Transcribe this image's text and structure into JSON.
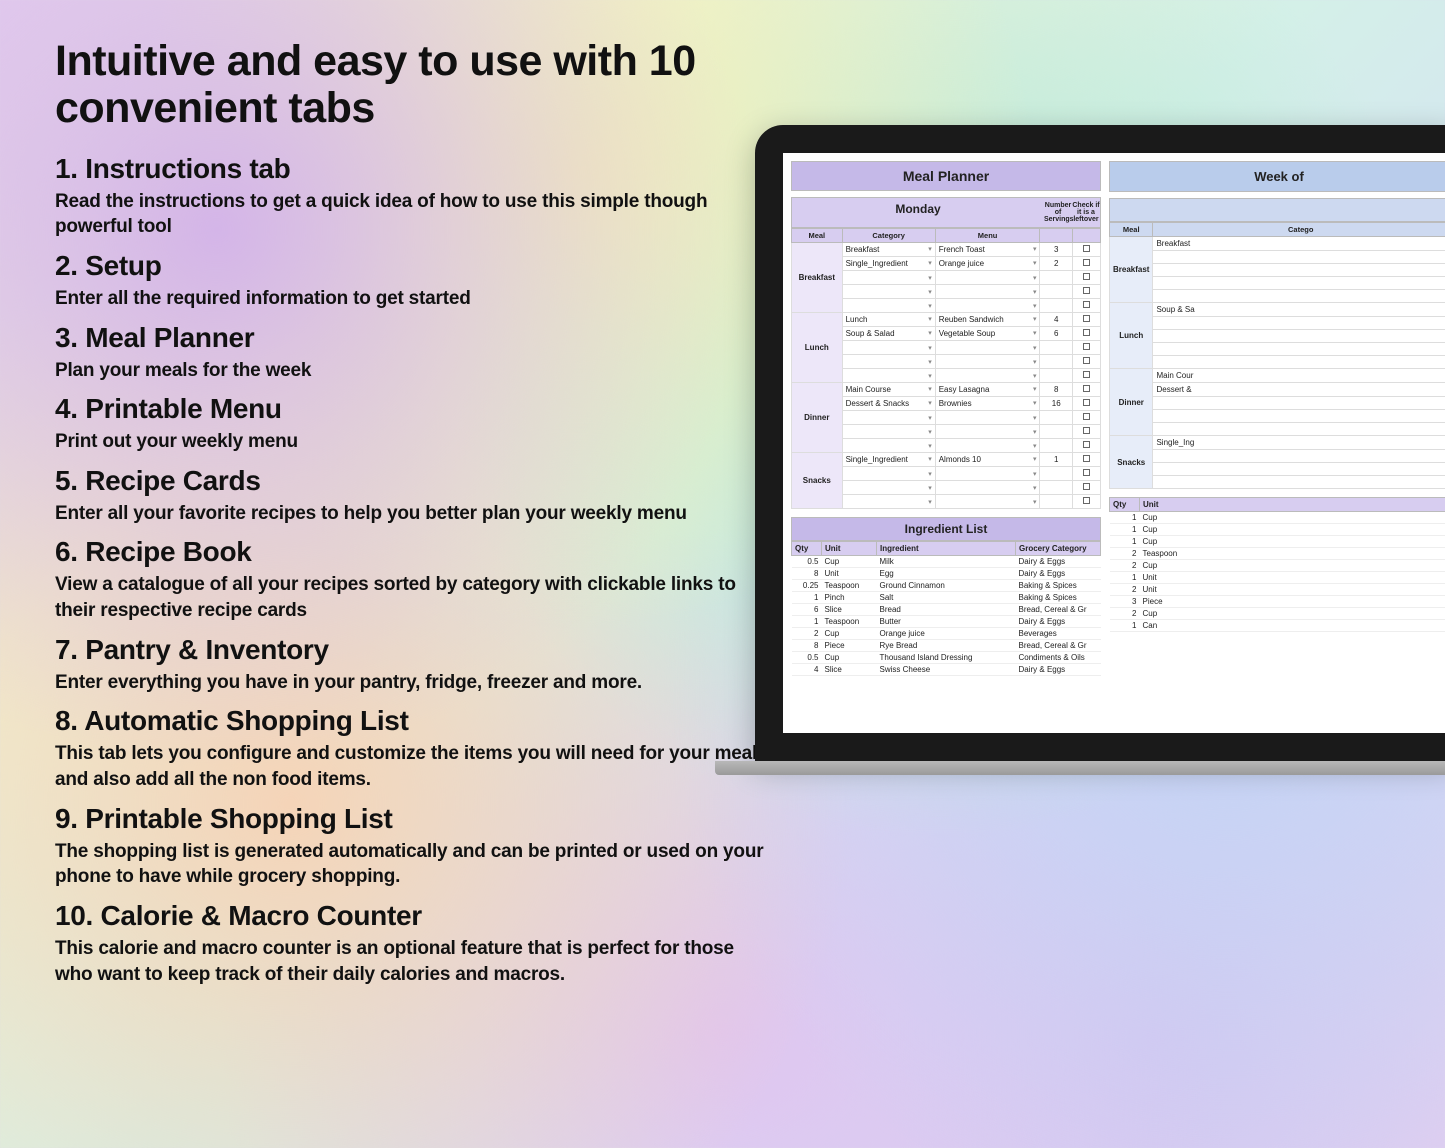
{
  "title": "Intuitive and easy to use with 10 convenient tabs",
  "sections": [
    {
      "title": "1. Instructions tab",
      "desc": "Read the instructions to get a quick idea of how to use this simple though powerful tool"
    },
    {
      "title": "2. Setup",
      "desc": "Enter all the required information to get started"
    },
    {
      "title": "3. Meal Planner",
      "desc": "Plan your meals for the week"
    },
    {
      "title": "4. Printable Menu",
      "desc": "Print out your weekly menu"
    },
    {
      "title": "5. Recipe Cards",
      "desc": "Enter all your favorite recipes to help you better plan your weekly menu"
    },
    {
      "title": "6. Recipe Book",
      "desc": "View a catalogue of all your recipes sorted by category with clickable links to their respective recipe cards"
    },
    {
      "title": "7. Pantry & Inventory",
      "desc": "Enter everything you have in your pantry, fridge, freezer and more."
    },
    {
      "title": "8. Automatic Shopping List",
      "desc": "This tab lets you configure and customize the items you will need for your meals and also add all the non food items."
    },
    {
      "title": "9. Printable Shopping List",
      "desc": "The shopping list is generated automatically and can be printed or used on your phone to have while grocery shopping."
    },
    {
      "title": "10. Calorie & Macro Counter",
      "desc": "This calorie and macro counter is an optional feature that is perfect for those who want to keep track of their daily calories and macros."
    }
  ],
  "planner": {
    "title": "Meal Planner",
    "week_label": "Week of",
    "day1": "Monday",
    "cols": {
      "meal": "Meal",
      "category": "Category",
      "menu": "Menu",
      "servings": "Number of Servings",
      "leftover": "Check if it is a leftover"
    },
    "meals": {
      "breakfast": {
        "label": "Breakfast",
        "rows": [
          {
            "cat": "Breakfast",
            "menu": "French Toast",
            "serv": "3"
          },
          {
            "cat": "Single_Ingredient",
            "menu": "Orange juice",
            "serv": "2"
          },
          {
            "cat": "",
            "menu": "",
            "serv": ""
          },
          {
            "cat": "",
            "menu": "",
            "serv": ""
          },
          {
            "cat": "",
            "menu": "",
            "serv": ""
          }
        ]
      },
      "lunch": {
        "label": "Lunch",
        "rows": [
          {
            "cat": "Lunch",
            "menu": "Reuben Sandwich",
            "serv": "4"
          },
          {
            "cat": "Soup & Salad",
            "menu": "Vegetable Soup",
            "serv": "6"
          },
          {
            "cat": "",
            "menu": "",
            "serv": ""
          },
          {
            "cat": "",
            "menu": "",
            "serv": ""
          },
          {
            "cat": "",
            "menu": "",
            "serv": ""
          }
        ]
      },
      "dinner": {
        "label": "Dinner",
        "rows": [
          {
            "cat": "Main Course",
            "menu": "Easy Lasagna",
            "serv": "8"
          },
          {
            "cat": "Dessert & Snacks",
            "menu": "Brownies",
            "serv": "16"
          },
          {
            "cat": "",
            "menu": "",
            "serv": ""
          },
          {
            "cat": "",
            "menu": "",
            "serv": ""
          },
          {
            "cat": "",
            "menu": "",
            "serv": ""
          }
        ]
      },
      "snacks": {
        "label": "Snacks",
        "rows": [
          {
            "cat": "Single_Ingredient",
            "menu": "Almonds 10",
            "serv": "1"
          },
          {
            "cat": "",
            "menu": "",
            "serv": ""
          },
          {
            "cat": "",
            "menu": "",
            "serv": ""
          },
          {
            "cat": "",
            "menu": "",
            "serv": ""
          }
        ]
      }
    },
    "day2_rows": {
      "breakfast": "Breakfast",
      "lunch": "Soup & Sa",
      "dinner1": "Main Cour",
      "dinner2": "Dessert &",
      "snacks": "Single_Ing"
    }
  },
  "ingredients": {
    "title": "Ingredient List",
    "cols": {
      "qty": "Qty",
      "unit": "Unit",
      "ingredient": "Ingredient",
      "grocery": "Grocery Category"
    },
    "rows": [
      {
        "qty": "0.5",
        "unit": "Cup",
        "ing": "Milk",
        "cat": "Dairy & Eggs"
      },
      {
        "qty": "8",
        "unit": "Unit",
        "ing": "Egg",
        "cat": "Dairy & Eggs"
      },
      {
        "qty": "0.25",
        "unit": "Teaspoon",
        "ing": "Ground Cinnamon",
        "cat": "Baking & Spices"
      },
      {
        "qty": "1",
        "unit": "Pinch",
        "ing": "Salt",
        "cat": "Baking & Spices"
      },
      {
        "qty": "6",
        "unit": "Slice",
        "ing": "Bread",
        "cat": "Bread, Cereal & Gr"
      },
      {
        "qty": "1",
        "unit": "Teaspoon",
        "ing": "Butter",
        "cat": "Dairy & Eggs"
      },
      {
        "qty": "2",
        "unit": "Cup",
        "ing": "Orange juice",
        "cat": "Beverages"
      },
      {
        "qty": "8",
        "unit": "Piece",
        "ing": "Rye Bread",
        "cat": "Bread, Cereal & Gr"
      },
      {
        "qty": "0.5",
        "unit": "Cup",
        "ing": "Thousand Island Dressing",
        "cat": "Condiments & Oils"
      },
      {
        "qty": "4",
        "unit": "Slice",
        "ing": "Swiss Cheese",
        "cat": "Dairy & Eggs"
      }
    ],
    "rows2": [
      {
        "qty": "1",
        "unit": "Cup"
      },
      {
        "qty": "1",
        "unit": "Cup"
      },
      {
        "qty": "1",
        "unit": "Cup"
      },
      {
        "qty": "2",
        "unit": "Teaspoon"
      },
      {
        "qty": "2",
        "unit": "Cup"
      },
      {
        "qty": "1",
        "unit": "Unit"
      },
      {
        "qty": "2",
        "unit": "Unit"
      },
      {
        "qty": "3",
        "unit": "Piece"
      },
      {
        "qty": "2",
        "unit": "Cup"
      },
      {
        "qty": "1",
        "unit": "Can"
      }
    ]
  }
}
